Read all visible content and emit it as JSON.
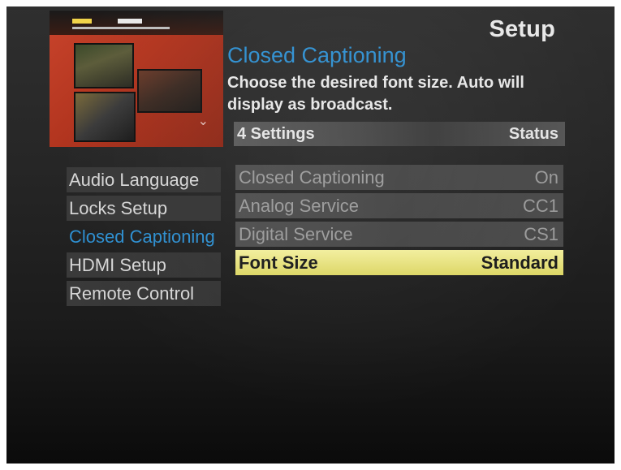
{
  "header": {
    "screen_title": "Setup",
    "section_title": "Closed Captioning",
    "description": "Choose the desired font size. Auto will display as broadcast."
  },
  "settings_header": {
    "count_label": "4 Settings",
    "status_label": "Status"
  },
  "side_menu": {
    "items": [
      {
        "label": "Audio Language"
      },
      {
        "label": "Locks Setup"
      },
      {
        "label": "Closed Captioning"
      },
      {
        "label": "HDMI Setup"
      },
      {
        "label": "Remote Control"
      }
    ],
    "active_item": "Closed Captioning"
  },
  "settings": {
    "rows": [
      {
        "label": "Closed Captioning",
        "value": "On"
      },
      {
        "label": "Analog Service",
        "value": "CC1"
      },
      {
        "label": "Digital Service",
        "value": "CS1"
      },
      {
        "label": "Font Size",
        "value": "Standard"
      }
    ],
    "selected_row": "Font Size"
  },
  "colors": {
    "accent_blue": "#2e8fd0",
    "highlight_yellow": "#e8e27c",
    "background": "#262626"
  }
}
